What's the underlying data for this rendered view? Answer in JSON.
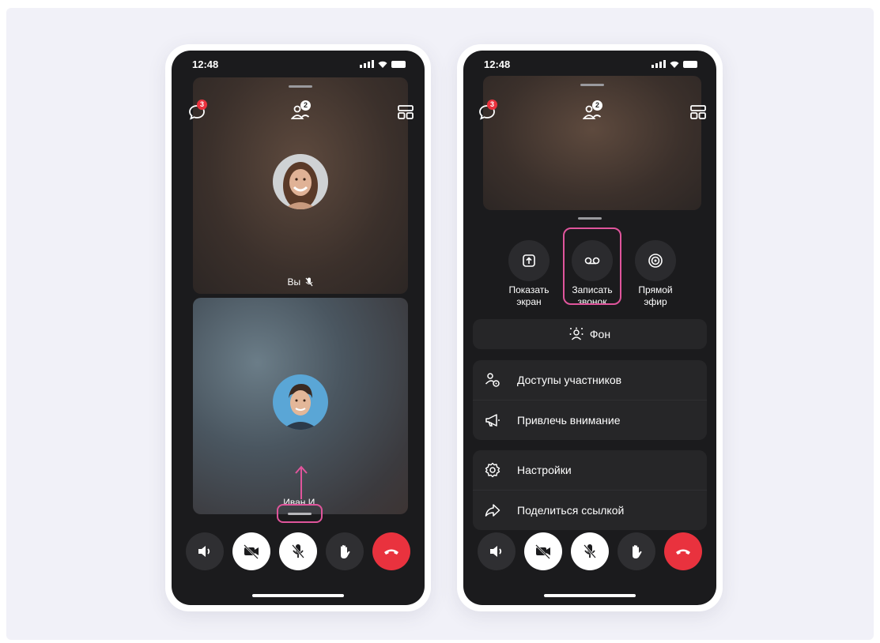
{
  "phone_left": {
    "status": {
      "time": "12:48"
    },
    "top_bar": {
      "chat_badge": "3",
      "participants_badge": "2"
    },
    "tiles": [
      {
        "label": "Вы",
        "muted": true
      },
      {
        "label": "Иван И."
      }
    ]
  },
  "phone_right": {
    "status": {
      "time": "12:48"
    },
    "top_bar": {
      "chat_badge": "3",
      "participants_badge": "2"
    },
    "actions": [
      {
        "label_line1": "Показать",
        "label_line2": "экран"
      },
      {
        "label_line1": "Записать",
        "label_line2": "звонок"
      },
      {
        "label_line1": "Прямой",
        "label_line2": "эфир"
      }
    ],
    "background_button": "Фон",
    "menu_group1": [
      {
        "label": "Доступы участников",
        "icon": "participants-access-icon"
      },
      {
        "label": "Привлечь внимание",
        "icon": "megaphone-icon"
      }
    ],
    "menu_group2": [
      {
        "label": "Настройки",
        "icon": "gear-icon"
      },
      {
        "label": "Поделиться ссылкой",
        "icon": "share-icon"
      }
    ]
  },
  "controls": [
    "speaker-icon",
    "camera-off-icon",
    "mic-off-icon",
    "raise-hand-icon",
    "end-call-icon"
  ],
  "colors": {
    "highlight": "#e0559c",
    "end_call": "#e9323e",
    "badge": "#e9323e",
    "screen_bg": "#1b1b1d"
  }
}
